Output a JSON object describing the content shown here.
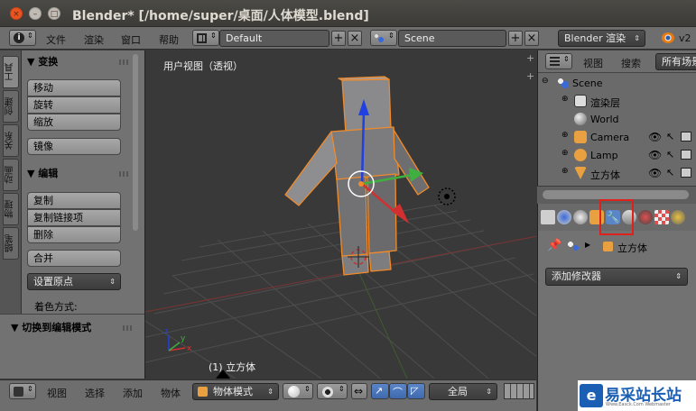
{
  "window": {
    "title": "Blender* [/home/super/桌面/人体模型.blend]",
    "close_glyph": "×",
    "minimize_glyph": "–",
    "maximize_glyph": "□"
  },
  "top_header": {
    "editor_icon": "info-icon",
    "menus": [
      "文件",
      "渲染",
      "窗口",
      "帮助"
    ],
    "screen_layout": "Default",
    "scene": "Scene",
    "render_engine": "Blender 渲染",
    "version": "v2"
  },
  "tool_shelf": {
    "tabs": [
      "工具",
      "创建",
      "关系",
      "动画",
      "物理",
      "蜡笔"
    ],
    "transform": {
      "header": "▼ 变换",
      "buttons": [
        "移动",
        "旋转",
        "缩放",
        "镜像"
      ]
    },
    "edit": {
      "header": "▼ 编辑",
      "buttons": [
        "复制",
        "复制链接项",
        "删除",
        "合并"
      ],
      "origin_dropdown": "设置原点",
      "shading_label": "着色方式:"
    },
    "operator_panel": "▼ 切换到编辑模式"
  },
  "viewport": {
    "label": "用户视图（透视）",
    "active_object": "(1) 立方体"
  },
  "bottom_header": {
    "menus": [
      "视图",
      "选择",
      "添加",
      "物体"
    ],
    "mode": "物体模式",
    "pivot": "全局"
  },
  "outliner": {
    "header_menus": [
      "视图",
      "搜索"
    ],
    "filter": "所有场景",
    "items": [
      {
        "label": "Scene",
        "icon": "scene-icon"
      },
      {
        "label": "渲染层",
        "icon": "render-layers-icon"
      },
      {
        "label": "World",
        "icon": "world-icon"
      },
      {
        "label": "Camera",
        "icon": "camera-icon"
      },
      {
        "label": "Lamp",
        "icon": "lamp-icon"
      },
      {
        "label": "立方体",
        "icon": "mesh-icon"
      }
    ]
  },
  "properties": {
    "active_tab": "modifier-wrench-icon",
    "breadcrumb_object": "立方体",
    "add_modifier": "添加修改器"
  },
  "watermark": {
    "text": "易采站长站",
    "subtext": "Www.Easck.Com  Webmaster"
  },
  "colors": {
    "highlight_box": "#e0201a",
    "selection_outline": "#f08a2a",
    "x_axis": "#d23030",
    "y_axis": "#3fb040",
    "z_axis": "#2040e0"
  }
}
